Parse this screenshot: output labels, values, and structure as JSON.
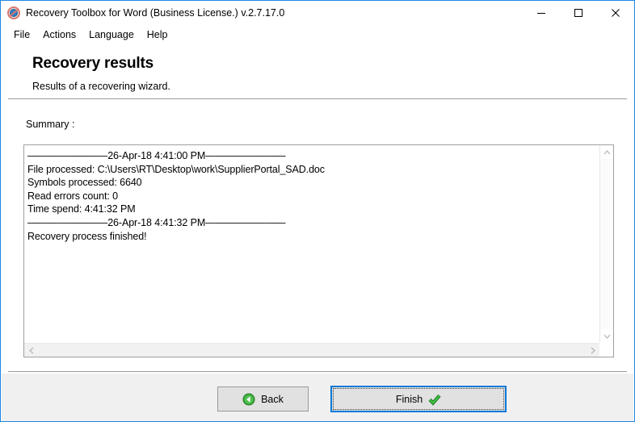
{
  "window": {
    "title": "Recovery Toolbox for Word (Business License.) v.2.7.17.0",
    "icon": "app-logo-icon",
    "accent_color": "#1e87e5",
    "controls": [
      {
        "name": "minimize",
        "glyph": "minimize-icon"
      },
      {
        "name": "maximize",
        "glyph": "maximize-icon"
      },
      {
        "name": "close",
        "glyph": "close-icon"
      }
    ]
  },
  "menubar": {
    "items": [
      {
        "label": "File"
      },
      {
        "label": "Actions"
      },
      {
        "label": "Language"
      },
      {
        "label": "Help"
      }
    ]
  },
  "header": {
    "title": "Recovery results",
    "subtitle": "Results of a recovering wizard."
  },
  "main": {
    "summary_label": "Summary :",
    "log_lines": [
      "————————26-Apr-18 4:41:00 PM————————",
      "File processed: C:\\Users\\RT\\Desktop\\work\\SupplierPortal_SAD.doc",
      "Symbols processed: 6640",
      "Read errors count: 0",
      "Time spend: 4:41:32 PM",
      "————————26-Apr-18 4:41:32 PM————————",
      "Recovery process finished!"
    ],
    "scrollbars": {
      "vertical": {
        "up_arrow": "chevron-up-icon",
        "down_arrow": "chevron-down-icon"
      },
      "horizontal": {
        "left_arrow": "chevron-left-icon",
        "right_arrow": "chevron-right-icon"
      }
    }
  },
  "footer": {
    "back_button": {
      "label": "Back",
      "icon": "back-arrow-icon",
      "icon_color": "#24a12a"
    },
    "finish_button": {
      "label": "Finish",
      "icon": "checkmark-icon",
      "icon_color": "#24a12a",
      "focused": true,
      "focus_color": "#0078d7"
    }
  }
}
